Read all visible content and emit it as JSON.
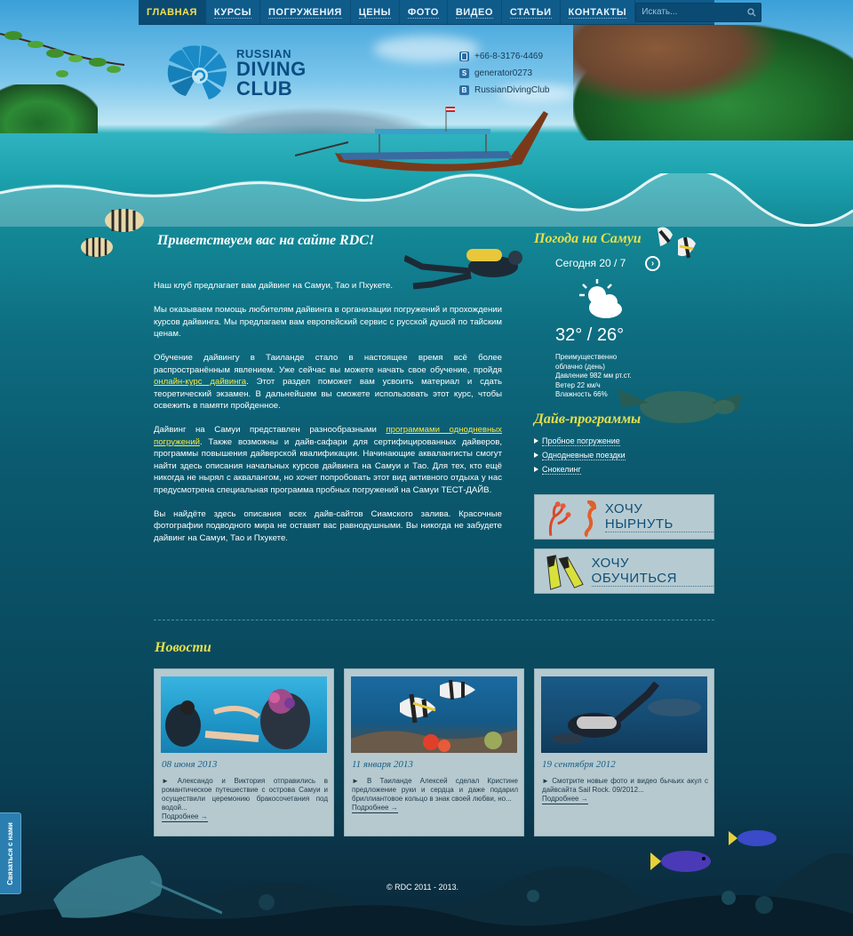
{
  "nav": {
    "items": [
      {
        "label": "ГЛАВНАЯ",
        "active": true
      },
      {
        "label": "КУРСЫ",
        "active": false
      },
      {
        "label": "ПОГРУЖЕНИЯ",
        "active": false
      },
      {
        "label": "ЦЕНЫ",
        "active": false
      },
      {
        "label": "ФОТО",
        "active": false
      },
      {
        "label": "ВИДЕО",
        "active": false
      },
      {
        "label": "СТАТЬИ",
        "active": false
      },
      {
        "label": "КОНТАКТЫ",
        "active": false
      }
    ],
    "search_placeholder": "Искать..."
  },
  "logo": {
    "line1": "RUSSIAN",
    "line2": "DIVING",
    "line3": "CLUB"
  },
  "contacts": {
    "phone": "+66-8-3176-4469",
    "skype": "generator0273",
    "vk": "RussianDivingClub"
  },
  "welcome": {
    "title": "Приветствуем вас на сайте RDC!",
    "p1": "Наш клуб предлагает вам дайвинг на Самуи, Тао и Пхукете.",
    "p2": "Мы оказываем помощь любителям дайвинга в организации погружений и прохождении курсов дайвинга. Мы предлагаем вам европейский сервис с русской душой по тайским ценам.",
    "p3_before": "Обучение дайвингу в Таиланде стало в настоящее время всё более распространённым явлением. Уже сейчас вы можете начать свое обучение, пройдя ",
    "p3_link": "онлайн-курс дайвинга",
    "p3_after": ". Этот раздел поможет вам усвоить материал и сдать теоретический экзамен. В дальнейшем вы сможете использовать этот курс, чтобы освежить в памяти пройденное.",
    "p4_before": "Дайвинг на Самуи представлен разнообразными ",
    "p4_link": "программами однодневных погружений",
    "p4_after": ". Также возможны и дайв-сафари для сертифицированных дайверов, программы повышения дайверской квалификации. Начинающие аквалангисты смогут найти здесь описания начальных курсов дайвинга на Самуи и Тао. Для тех, кто ещё никогда не нырял с аквалангом, но хочет попробовать этот вид активного отдыха у нас предусмотрена специальная программа пробных погружений на Самуи ТЕСТ-ДАЙВ.",
    "p5": "Вы найдёте здесь описания всех дайв-сайтов Сиамского залива. Красочные фотографии подводного мира не оставят вас равнодушными. Вы никогда не забудете дайвинг на Самуи, Тао и Пхукете."
  },
  "weather": {
    "title": "Погода на Самуи",
    "date": "Сегодня 20 / 7",
    "temp": "32° / 26°",
    "details": [
      "Преимущественно",
      "облачно (день)",
      "Давление 982 мм рт.ст.",
      "Ветер 22 км/ч",
      "Влажность 66%"
    ]
  },
  "dive_programs": {
    "title": "Дайв-программы",
    "items": [
      "Пробное погружение",
      "Однодневные поездки",
      "Снокелинг"
    ]
  },
  "cta": {
    "dive": "ХОЧУ НЫРНУТЬ",
    "learn": "ХОЧУ ОБУЧИТЬСЯ"
  },
  "news": {
    "title": "Новости",
    "items": [
      {
        "date": "08 июня 2013",
        "text": "► Александо и Виктория отправились в романтическое путешествие с острова Самуи и осуществили церемонию бракосочетания под водой...",
        "more": "Подробнее →"
      },
      {
        "date": "11 января 2013",
        "text": "► В Таиланде Алексей сделал Кристине предложение руки и сердца и даже подарил бриллиантовое кольцо в знак своей любви, но...",
        "more": "Подробнее →"
      },
      {
        "date": "19 сентября 2012",
        "text": "► Смотрите новые фото и видео бычьих акул с дайвсайта Sail Rock. 09/2012...",
        "more": "Подробнее →"
      }
    ]
  },
  "footer": {
    "copyright": "© RDC 2011 - 2013."
  },
  "feedback": {
    "label": "Связаться с нами"
  }
}
